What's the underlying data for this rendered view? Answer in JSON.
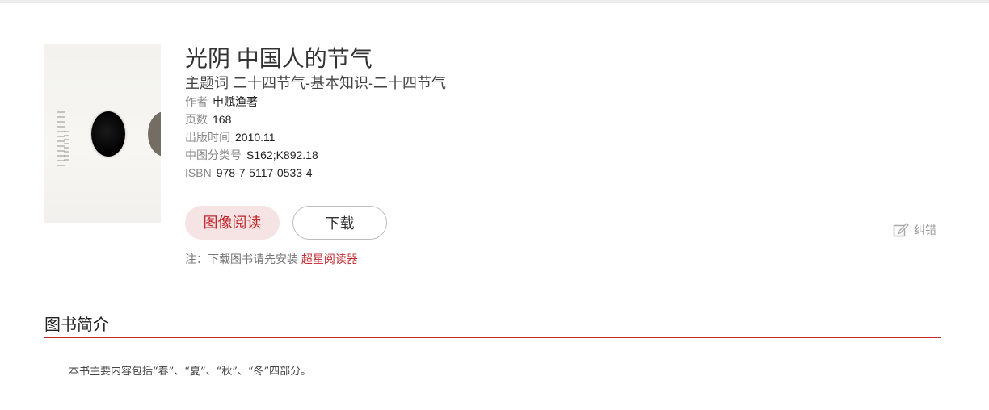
{
  "book": {
    "title": "光阴 中国人的节气",
    "subject": "主题词 二十四节气-基本知识-二十四节气",
    "meta": [
      {
        "label": "作者",
        "value": "申赋渔著"
      },
      {
        "label": "页数",
        "value": "168"
      },
      {
        "label": "出版时间",
        "value": "2010.11"
      },
      {
        "label": "中图分类号",
        "value": "S162;K892.18"
      },
      {
        "label": "ISBN",
        "value": "978-7-5117-0533-4"
      }
    ]
  },
  "actions": {
    "read_label": "图像阅读",
    "download_label": "下载"
  },
  "note": {
    "prefix": "注：下载图书请先安装 ",
    "link": "超星阅读器"
  },
  "report": {
    "label": "纠错",
    "icon": "edit-icon"
  },
  "intro": {
    "heading": "图书简介",
    "text": "本书主要内容包括“春”、“夏”、“秋”、“冬”四部分。"
  },
  "colors": {
    "accent": "#c1272d",
    "read_button_bg": "#f6e3e3"
  }
}
